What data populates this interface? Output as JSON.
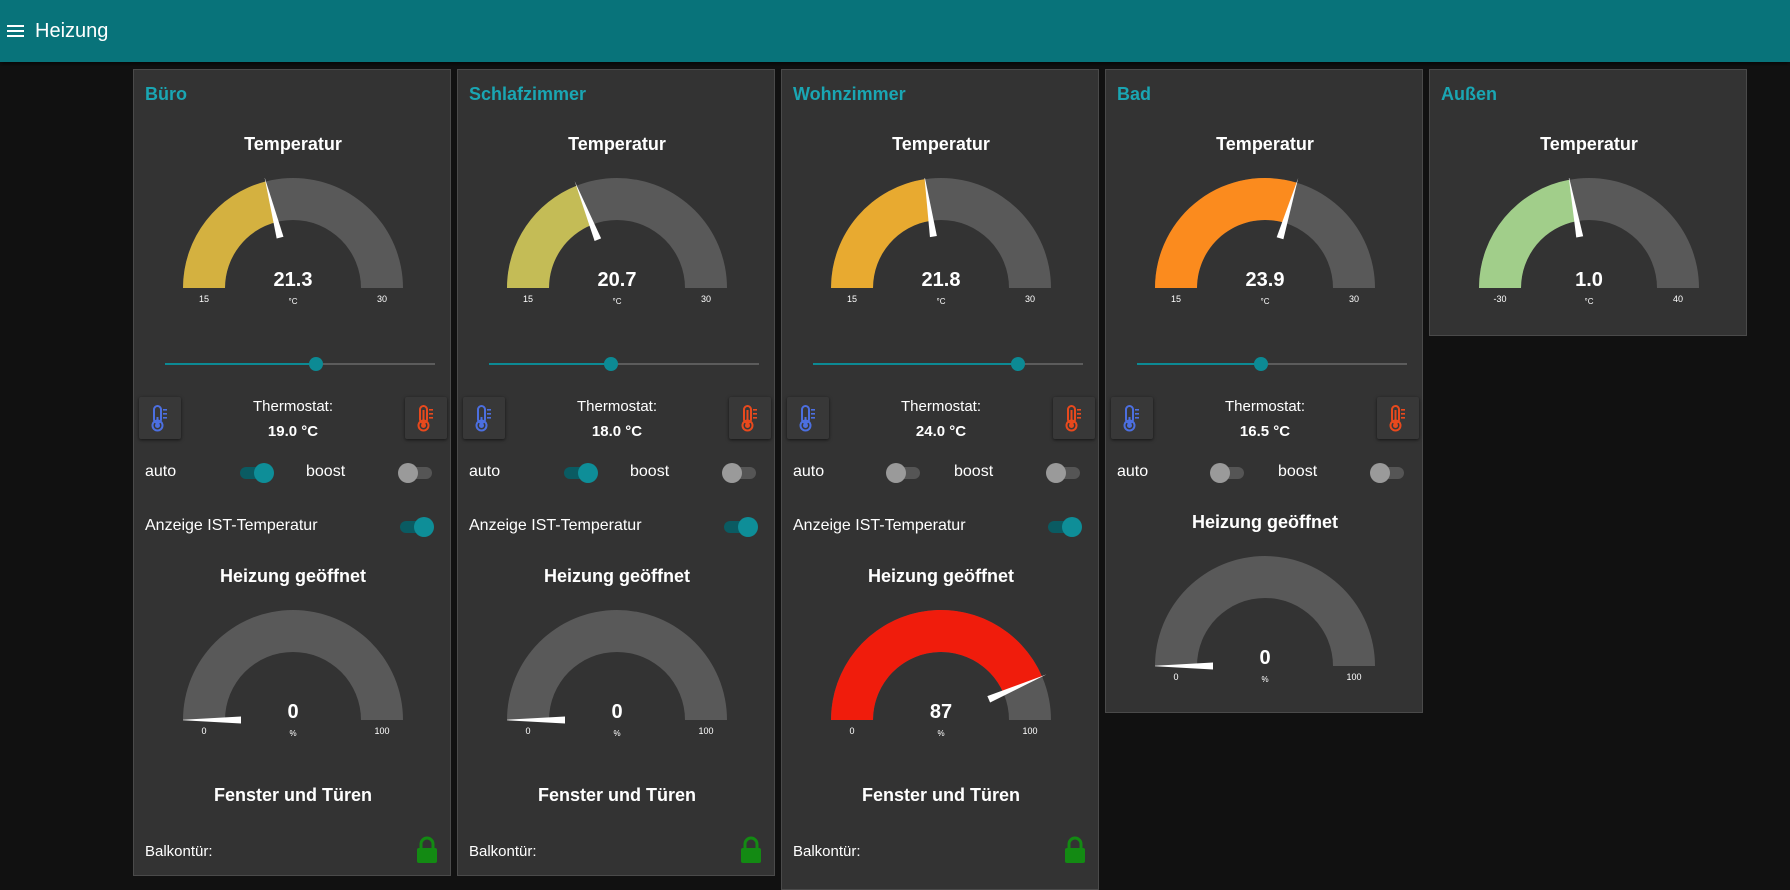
{
  "header": {
    "title": "Heizung"
  },
  "labels": {
    "temperature": "Temperatur",
    "thermostat": "Thermostat:",
    "auto": "auto",
    "boost": "boost",
    "ist": "Anzeige IST-Temperatur",
    "valve": "Heizung geöffnet",
    "windows": "Fenster und Türen",
    "balcony": "Balkontür:"
  },
  "icons": {
    "menu": "hamburger-menu-icon",
    "cold": "thermometer-cold-icon",
    "hot": "thermometer-hot-icon",
    "lock": "lock-closed-icon"
  },
  "colors": {
    "accent": "#08737a",
    "card": "#333333",
    "gauge_bg": "#595959",
    "cold_icon": "#4c6fe0",
    "hot_icon": "#e8491d",
    "lock": "#138a13"
  },
  "rooms": [
    {
      "name": "Büro",
      "temp": {
        "value": "21.3",
        "unit": "°C",
        "min": "15",
        "max": "30",
        "color": "#d4b140"
      },
      "thermostat": {
        "value": "19.0 °C",
        "slider": 0.56
      },
      "auto_on": true,
      "boost_on": false,
      "ist_on": true,
      "valve": {
        "value": "0",
        "unit": "%",
        "min": "0",
        "max": "100",
        "color": "#595959"
      }
    },
    {
      "name": "Schlafzimmer",
      "temp": {
        "value": "20.7",
        "unit": "°C",
        "min": "15",
        "max": "30",
        "color": "#c4bc56"
      },
      "thermostat": {
        "value": "18.0 °C",
        "slider": 0.45
      },
      "auto_on": true,
      "boost_on": false,
      "ist_on": true,
      "valve": {
        "value": "0",
        "unit": "%",
        "min": "0",
        "max": "100",
        "color": "#595959"
      }
    },
    {
      "name": "Wohnzimmer",
      "temp": {
        "value": "21.8",
        "unit": "°C",
        "min": "15",
        "max": "30",
        "color": "#e8aa30"
      },
      "thermostat": {
        "value": "24.0 °C",
        "slider": 0.76
      },
      "auto_on": false,
      "boost_on": false,
      "ist_on": true,
      "valve": {
        "value": "87",
        "unit": "%",
        "min": "0",
        "max": "100",
        "color": "#f01c0c"
      }
    },
    {
      "name": "Bad",
      "temp": {
        "value": "23.9",
        "unit": "°C",
        "min": "15",
        "max": "30",
        "color": "#fb8b1e"
      },
      "thermostat": {
        "value": "16.5 °C",
        "slider": 0.46
      },
      "auto_on": false,
      "boost_on": false,
      "valve": {
        "value": "0",
        "unit": "%",
        "min": "0",
        "max": "100",
        "color": "#595959"
      }
    },
    {
      "name": "Außen",
      "temp": {
        "value": "1.0",
        "unit": "°C",
        "min": "-30",
        "max": "40",
        "color": "#a1ce8a"
      }
    }
  ]
}
